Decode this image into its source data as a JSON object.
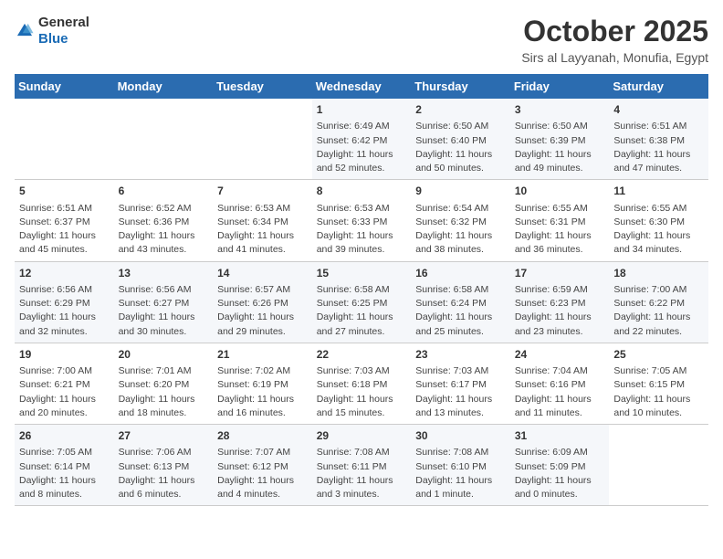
{
  "logo": {
    "text_general": "General",
    "text_blue": "Blue"
  },
  "title": "October 2025",
  "subtitle": "Sirs al Layyanah, Monufia, Egypt",
  "headers": [
    "Sunday",
    "Monday",
    "Tuesday",
    "Wednesday",
    "Thursday",
    "Friday",
    "Saturday"
  ],
  "weeks": [
    [
      {
        "day": "",
        "info": ""
      },
      {
        "day": "",
        "info": ""
      },
      {
        "day": "",
        "info": ""
      },
      {
        "day": "1",
        "info": "Sunrise: 6:49 AM\nSunset: 6:42 PM\nDaylight: 11 hours\nand 52 minutes."
      },
      {
        "day": "2",
        "info": "Sunrise: 6:50 AM\nSunset: 6:40 PM\nDaylight: 11 hours\nand 50 minutes."
      },
      {
        "day": "3",
        "info": "Sunrise: 6:50 AM\nSunset: 6:39 PM\nDaylight: 11 hours\nand 49 minutes."
      },
      {
        "day": "4",
        "info": "Sunrise: 6:51 AM\nSunset: 6:38 PM\nDaylight: 11 hours\nand 47 minutes."
      }
    ],
    [
      {
        "day": "5",
        "info": "Sunrise: 6:51 AM\nSunset: 6:37 PM\nDaylight: 11 hours\nand 45 minutes."
      },
      {
        "day": "6",
        "info": "Sunrise: 6:52 AM\nSunset: 6:36 PM\nDaylight: 11 hours\nand 43 minutes."
      },
      {
        "day": "7",
        "info": "Sunrise: 6:53 AM\nSunset: 6:34 PM\nDaylight: 11 hours\nand 41 minutes."
      },
      {
        "day": "8",
        "info": "Sunrise: 6:53 AM\nSunset: 6:33 PM\nDaylight: 11 hours\nand 39 minutes."
      },
      {
        "day": "9",
        "info": "Sunrise: 6:54 AM\nSunset: 6:32 PM\nDaylight: 11 hours\nand 38 minutes."
      },
      {
        "day": "10",
        "info": "Sunrise: 6:55 AM\nSunset: 6:31 PM\nDaylight: 11 hours\nand 36 minutes."
      },
      {
        "day": "11",
        "info": "Sunrise: 6:55 AM\nSunset: 6:30 PM\nDaylight: 11 hours\nand 34 minutes."
      }
    ],
    [
      {
        "day": "12",
        "info": "Sunrise: 6:56 AM\nSunset: 6:29 PM\nDaylight: 11 hours\nand 32 minutes."
      },
      {
        "day": "13",
        "info": "Sunrise: 6:56 AM\nSunset: 6:27 PM\nDaylight: 11 hours\nand 30 minutes."
      },
      {
        "day": "14",
        "info": "Sunrise: 6:57 AM\nSunset: 6:26 PM\nDaylight: 11 hours\nand 29 minutes."
      },
      {
        "day": "15",
        "info": "Sunrise: 6:58 AM\nSunset: 6:25 PM\nDaylight: 11 hours\nand 27 minutes."
      },
      {
        "day": "16",
        "info": "Sunrise: 6:58 AM\nSunset: 6:24 PM\nDaylight: 11 hours\nand 25 minutes."
      },
      {
        "day": "17",
        "info": "Sunrise: 6:59 AM\nSunset: 6:23 PM\nDaylight: 11 hours\nand 23 minutes."
      },
      {
        "day": "18",
        "info": "Sunrise: 7:00 AM\nSunset: 6:22 PM\nDaylight: 11 hours\nand 22 minutes."
      }
    ],
    [
      {
        "day": "19",
        "info": "Sunrise: 7:00 AM\nSunset: 6:21 PM\nDaylight: 11 hours\nand 20 minutes."
      },
      {
        "day": "20",
        "info": "Sunrise: 7:01 AM\nSunset: 6:20 PM\nDaylight: 11 hours\nand 18 minutes."
      },
      {
        "day": "21",
        "info": "Sunrise: 7:02 AM\nSunset: 6:19 PM\nDaylight: 11 hours\nand 16 minutes."
      },
      {
        "day": "22",
        "info": "Sunrise: 7:03 AM\nSunset: 6:18 PM\nDaylight: 11 hours\nand 15 minutes."
      },
      {
        "day": "23",
        "info": "Sunrise: 7:03 AM\nSunset: 6:17 PM\nDaylight: 11 hours\nand 13 minutes."
      },
      {
        "day": "24",
        "info": "Sunrise: 7:04 AM\nSunset: 6:16 PM\nDaylight: 11 hours\nand 11 minutes."
      },
      {
        "day": "25",
        "info": "Sunrise: 7:05 AM\nSunset: 6:15 PM\nDaylight: 11 hours\nand 10 minutes."
      }
    ],
    [
      {
        "day": "26",
        "info": "Sunrise: 7:05 AM\nSunset: 6:14 PM\nDaylight: 11 hours\nand 8 minutes."
      },
      {
        "day": "27",
        "info": "Sunrise: 7:06 AM\nSunset: 6:13 PM\nDaylight: 11 hours\nand 6 minutes."
      },
      {
        "day": "28",
        "info": "Sunrise: 7:07 AM\nSunset: 6:12 PM\nDaylight: 11 hours\nand 4 minutes."
      },
      {
        "day": "29",
        "info": "Sunrise: 7:08 AM\nSunset: 6:11 PM\nDaylight: 11 hours\nand 3 minutes."
      },
      {
        "day": "30",
        "info": "Sunrise: 7:08 AM\nSunset: 6:10 PM\nDaylight: 11 hours\nand 1 minute."
      },
      {
        "day": "31",
        "info": "Sunrise: 6:09 AM\nSunset: 5:09 PM\nDaylight: 11 hours\nand 0 minutes."
      },
      {
        "day": "",
        "info": ""
      }
    ]
  ]
}
